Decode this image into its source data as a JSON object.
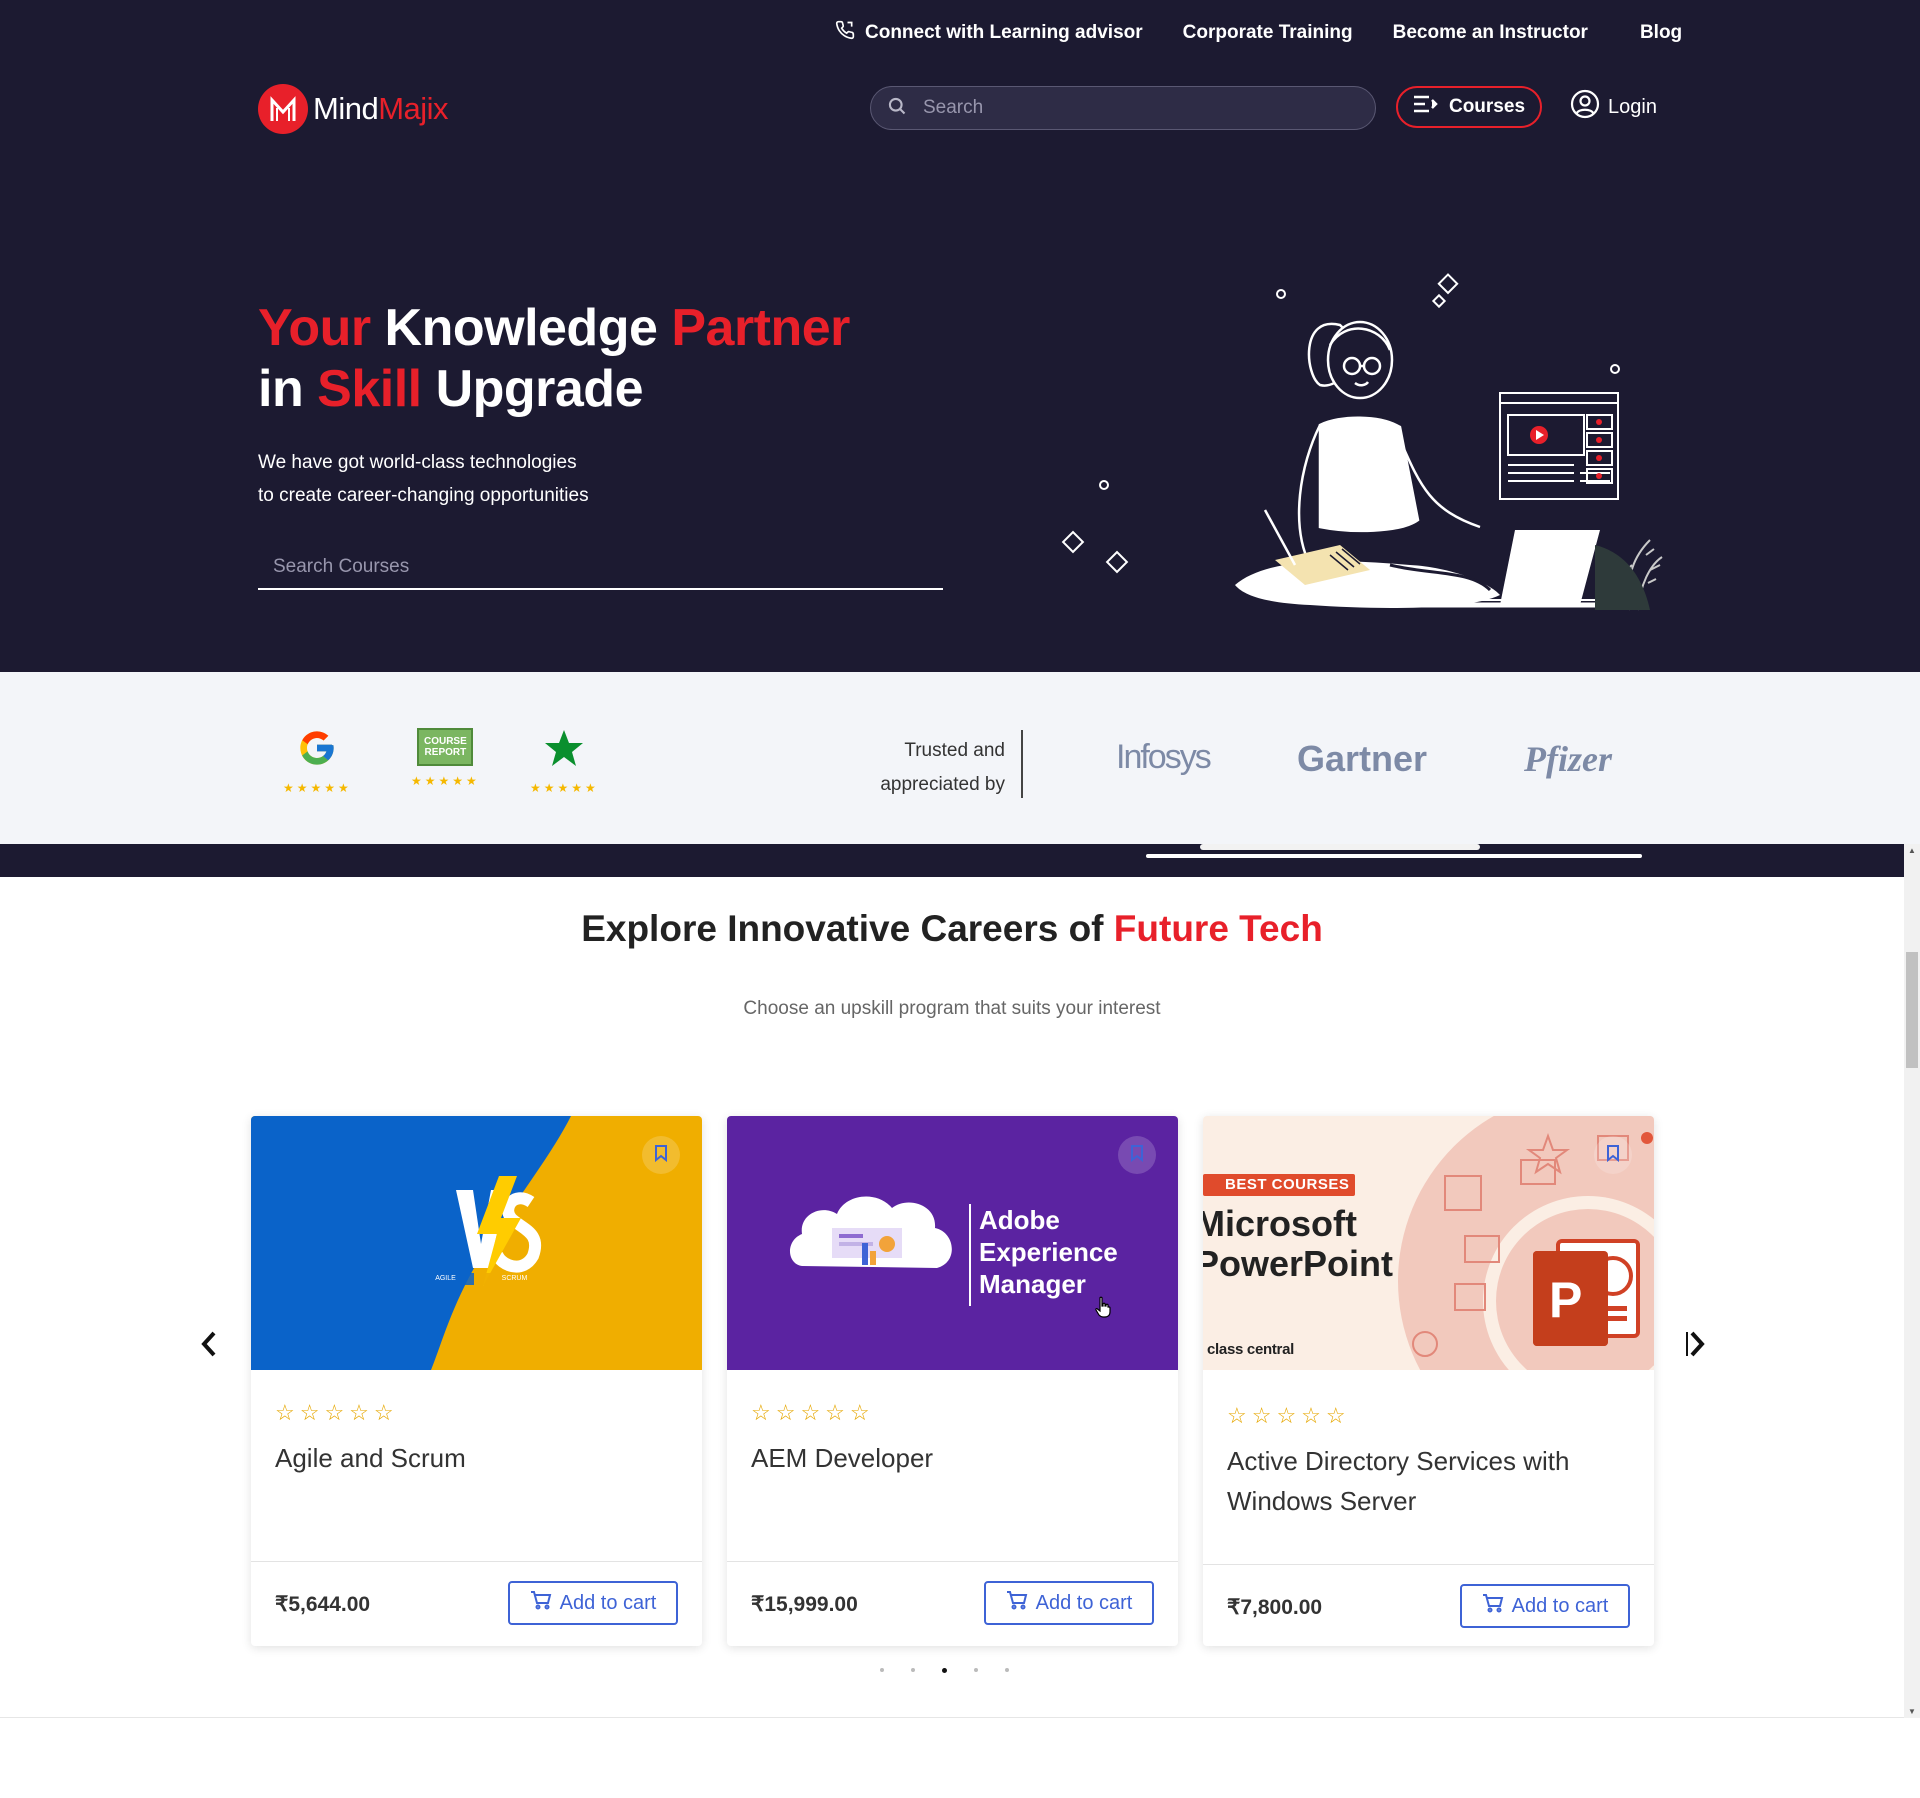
{
  "topnav": {
    "advisor": "Connect with Learning advisor",
    "corporate": "Corporate Training",
    "instructor": "Become an Instructor",
    "blog": "Blog"
  },
  "logo": {
    "part1": "Mind",
    "part2": "Majix"
  },
  "search": {
    "placeholder": "Search"
  },
  "courses_button": "Courses",
  "login": "Login",
  "hero": {
    "h_your": "Your",
    "h_knowledge": " Knowledge ",
    "h_partner": "Partner",
    "h_in": "in ",
    "h_skill": "Skill",
    "h_upgrade": " Upgrade",
    "sub1": "We have got world-class technologies",
    "sub2": "to create career-changing opportunities",
    "search_placeholder": "Search Courses"
  },
  "trust": {
    "trusted_line1": "Trusted and",
    "trusted_line2": "appreciated by",
    "review_sites": [
      "G",
      "COURSE REPORT",
      "★"
    ],
    "stars": "★★★★★",
    "brands": [
      "Infosys",
      "Gartner",
      "Pfizer"
    ]
  },
  "explore": {
    "title_main": "Explore Innovative Careers of ",
    "title_accent": "Future Tech",
    "subtitle": "Choose an upskill program that suits your interest"
  },
  "cards": [
    {
      "title": "Agile and Scrum",
      "price": "₹5,644.00",
      "cart": "Add to cart",
      "rating": "☆☆☆☆☆",
      "img_text": {
        "vs": "VS",
        "left": "AGILE",
        "right": "SCRUM"
      }
    },
    {
      "title": "AEM Developer",
      "price": "₹15,999.00",
      "cart": "Add to cart",
      "rating": "☆☆☆☆☆",
      "img_text": {
        "l1": "Adobe",
        "l2": "Experience",
        "l3": "Manager"
      }
    },
    {
      "title": "Active Directory Services with Windows Server",
      "price": "₹7,800.00",
      "cart": "Add to cart",
      "rating": "☆☆☆☆☆",
      "img_text": {
        "badge": "BEST COURSES",
        "l1": "Microsoft",
        "l2": "PowerPoint",
        "src": "class central",
        "p": "P"
      }
    }
  ],
  "carousel": {
    "dots": 5,
    "active_dot": 3
  },
  "colors": {
    "brand_red": "#e8202a",
    "hero_bg": "#1c1a31",
    "cart_blue": "#3e63d6",
    "star_gold": "#e6a700"
  }
}
